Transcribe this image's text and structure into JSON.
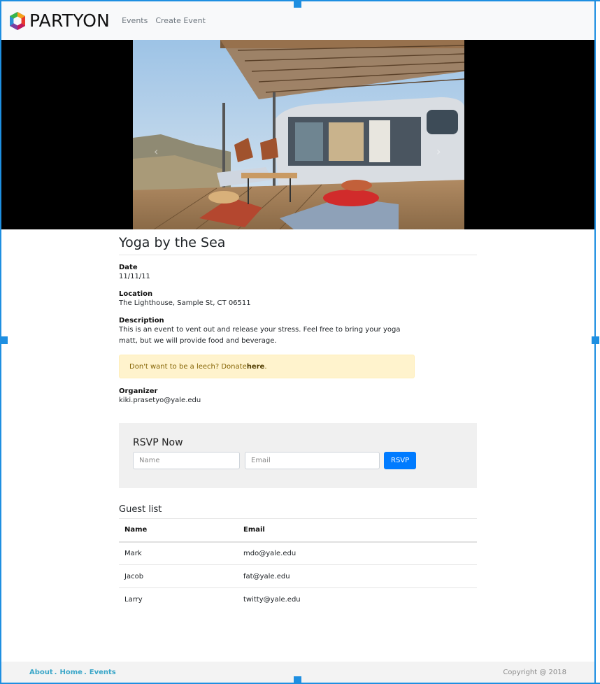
{
  "navbar": {
    "brand": "PARTYON",
    "links": [
      "Events",
      "Create Event"
    ]
  },
  "event": {
    "title": "Yoga by the Sea",
    "date_label": "Date",
    "date": "11/11/11",
    "location_label": "Location",
    "location": "The Lighthouse, Sample St, CT 06511",
    "description_label": "Description",
    "description": "This is an event to vent out and release your stress. Feel free to bring your yoga matt, but we will provide food and beverage.",
    "alert_text": "Don't want to be a leech? Donate ",
    "alert_link": "here",
    "alert_end": ".",
    "organizer_label": "Organizer",
    "organizer": "kiki.prasetyo@yale.edu"
  },
  "rsvp": {
    "title": "RSVP Now",
    "name_placeholder": "Name",
    "email_placeholder": "Email",
    "button": "RSVP"
  },
  "guests": {
    "title": "Guest list",
    "columns": [
      "Name",
      "Email"
    ],
    "rows": [
      {
        "name": "Mark",
        "email": "mdo@yale.edu"
      },
      {
        "name": "Jacob",
        "email": "fat@yale.edu"
      },
      {
        "name": "Larry",
        "email": "twitty@yale.edu"
      }
    ]
  },
  "footer": {
    "links": [
      "About",
      "Home",
      "Events"
    ],
    "separator": ".",
    "copyright": "Copyright @ 2018"
  },
  "colors": {
    "accent": "#007bff",
    "frame": "#1e8fe1",
    "alert_bg": "#fff3cd",
    "footer_link": "#3aa6c8"
  }
}
